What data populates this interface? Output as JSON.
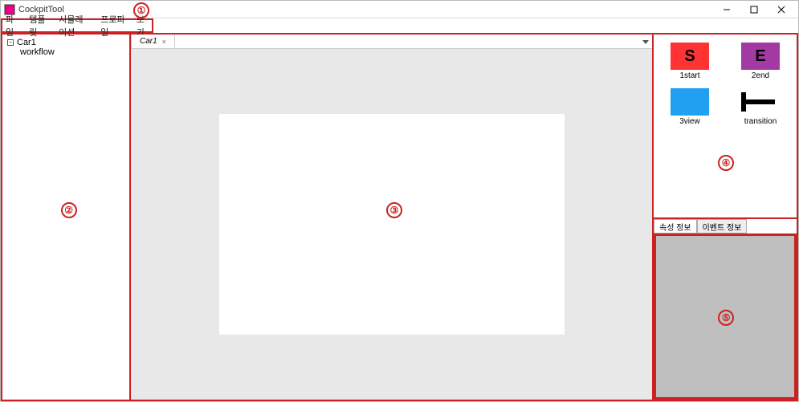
{
  "title": "CockpitTool",
  "menu": {
    "items": [
      "파일",
      "템플릿",
      "시뮬레이션",
      "프로파일",
      "보기"
    ]
  },
  "tree": {
    "root": "Car1",
    "child": "workflow"
  },
  "tabs": {
    "items": [
      "Car1"
    ]
  },
  "palette": {
    "items": [
      {
        "shape_text": "S",
        "label": "1start",
        "shape_class": "red"
      },
      {
        "shape_text": "E",
        "label": "2end",
        "shape_class": "purple"
      },
      {
        "shape_text": "",
        "label": "3view",
        "shape_class": "blue"
      },
      {
        "shape_text": "",
        "label": "transition",
        "shape_class": "transition"
      }
    ]
  },
  "props_tabs": {
    "items": [
      "속성 정보",
      "이벤트 정보"
    ]
  },
  "callouts": {
    "c1": "①",
    "c2": "②",
    "c3": "③",
    "c4": "④",
    "c5": "⑤"
  }
}
